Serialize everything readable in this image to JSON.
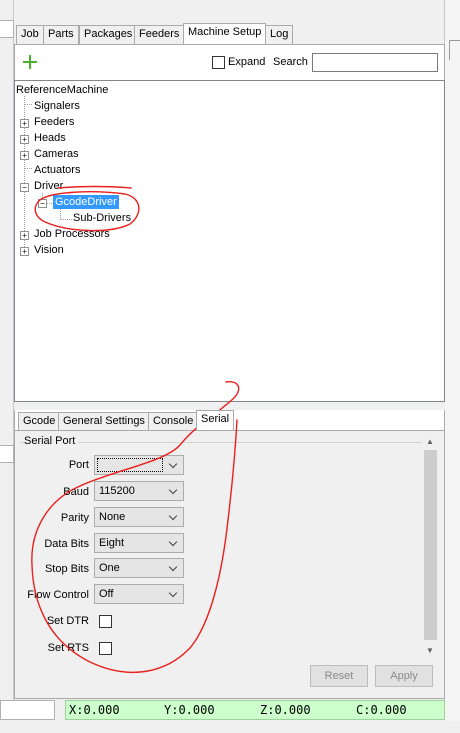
{
  "main_tabs": [
    "Job",
    "Parts",
    "Packages",
    "Feeders",
    "Machine Setup",
    "Log"
  ],
  "active_main_tab": "Machine Setup",
  "toolbar": {
    "add_icon": "plus-icon",
    "expand_label": "Expand",
    "search_label": "Search",
    "search_value": ""
  },
  "tree": {
    "root": "ReferenceMachine",
    "nodes": [
      "Signalers",
      "Feeders",
      "Heads",
      "Cameras",
      "Actuators",
      "Driver",
      "Job Processors",
      "Vision"
    ],
    "driver_children": [
      "GcodeDriver"
    ],
    "gcode_children": [
      "Sub-Drivers"
    ],
    "selected": "GcodeDriver",
    "expand_glyph": "+",
    "collapse_glyph": "−"
  },
  "sub_tabs": [
    "Gcode",
    "General Settings",
    "Console",
    "Serial"
  ],
  "active_sub_tab": "Serial",
  "serial": {
    "group_label": "Serial Port",
    "port_label": "Port",
    "port_value": "",
    "baud_label": "Baud",
    "baud_value": "115200",
    "parity_label": "Parity",
    "parity_value": "None",
    "data_bits_label": "Data Bits",
    "data_bits_value": "Eight",
    "stop_bits_label": "Stop Bits",
    "stop_bits_value": "One",
    "flow_control_label": "Flow Control",
    "flow_control_value": "Off",
    "set_dtr_label": "Set DTR",
    "set_dtr_checked": false,
    "set_rts_label": "Set RTS",
    "set_rts_checked": false
  },
  "buttons": {
    "reset": "Reset",
    "apply": "Apply"
  },
  "dro": {
    "x": "X:0.000",
    "y": "Y:0.000",
    "z": "Z:0.000",
    "c": "C:0.000"
  },
  "colors": {
    "selection": "#3399ff",
    "add_icon": "#4caf2a",
    "dro_background": "#ccffcc",
    "annotation": "#e8201e"
  }
}
